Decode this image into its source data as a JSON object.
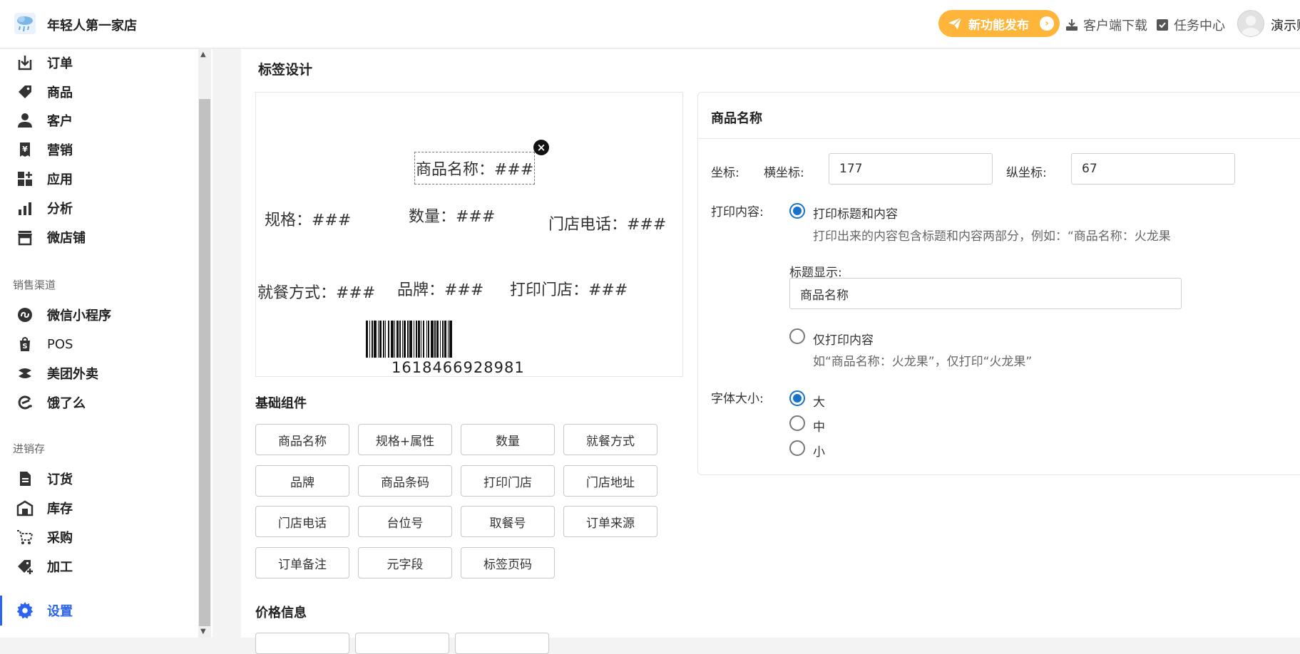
{
  "header": {
    "shop_name": "年轻人第一家店",
    "new_feature": "新功能发布",
    "client_download": "客户端下载",
    "task_center": "任务中心",
    "user_name": "演示账号"
  },
  "sidebar": {
    "items": [
      {
        "label": "订单",
        "icon": "download-icon"
      },
      {
        "label": "商品",
        "icon": "tag-icon"
      },
      {
        "label": "客户",
        "icon": "user-icon"
      },
      {
        "label": "营销",
        "icon": "yen-receipt-icon"
      },
      {
        "label": "应用",
        "icon": "apps-icon"
      },
      {
        "label": "分析",
        "icon": "bar-chart-icon"
      },
      {
        "label": "微店铺",
        "icon": "store-icon"
      }
    ],
    "section_sales": "销售渠道",
    "sales_items": [
      {
        "label": "微信小程序",
        "icon": "mini-program-icon"
      },
      {
        "label": "POS",
        "icon": "pos-bag-icon"
      },
      {
        "label": "美团外卖",
        "icon": "meituan-icon"
      },
      {
        "label": "饿了么",
        "icon": "eleme-icon"
      }
    ],
    "section_inventory": "进销存",
    "inventory_items": [
      {
        "label": "订货",
        "icon": "document-icon"
      },
      {
        "label": "库存",
        "icon": "warehouse-icon"
      },
      {
        "label": "采购",
        "icon": "cart-icon"
      },
      {
        "label": "加工",
        "icon": "tag-plus-icon"
      }
    ],
    "settings": {
      "label": "设置",
      "icon": "gear-icon"
    }
  },
  "main": {
    "page_title": "标签设计",
    "canvas": {
      "fields": [
        {
          "label": "商品名称：###"
        },
        {
          "label": "规格：###"
        },
        {
          "label": "数量：###"
        },
        {
          "label": "门店电话：###"
        },
        {
          "label": "就餐方式：###"
        },
        {
          "label": "品牌：###"
        },
        {
          "label": "打印门店：###"
        }
      ],
      "barcode_number": "1618466928981"
    },
    "basic_group_title": "基础组件",
    "basic_components": [
      "商品名称",
      "规格+属性",
      "数量",
      "就餐方式",
      "品牌",
      "商品条码",
      "打印门店",
      "门店地址",
      "门店电话",
      "台位号",
      "取餐号",
      "订单来源",
      "订单备注",
      "元字段",
      "标签页码"
    ],
    "price_group_title": "价格信息"
  },
  "props": {
    "title": "商品名称",
    "coord_label": "坐标:",
    "x_label": "横坐标:",
    "x_value": "177",
    "y_label": "纵坐标:",
    "y_value": "67",
    "print_content_label": "打印内容:",
    "option_title_and_content": "打印标题和内容",
    "option_title_and_content_hint": "打印出来的内容包含标题和内容两部分，例如：“商品名称：火龙果",
    "title_display_label": "标题显示:",
    "title_display_value": "商品名称",
    "option_content_only": "仅打印内容",
    "option_content_only_hint": "如“商品名称：火龙果”，仅打印“火龙果”",
    "font_size_label": "字体大小:",
    "font_sizes": [
      "大",
      "中",
      "小"
    ],
    "accent_color": "#1a73c8"
  }
}
